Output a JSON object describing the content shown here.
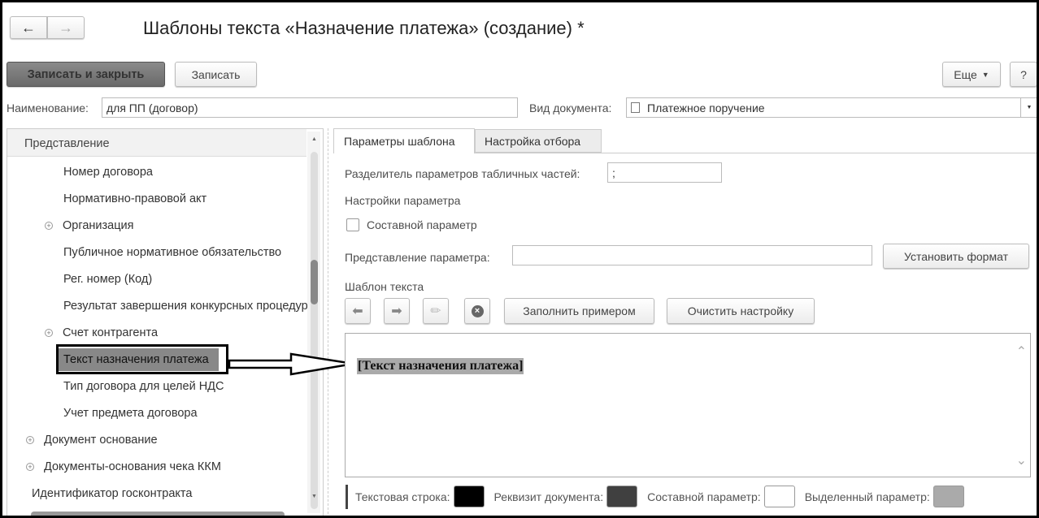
{
  "header": {
    "title": "Шаблоны текста «Назначение платежа» (создание) *"
  },
  "toolbar": {
    "save_close": "Записать и закрыть",
    "save": "Записать",
    "more": "Еще",
    "help": "?"
  },
  "form": {
    "name_label": "Наименование:",
    "name_value": "для ПП (договор)",
    "doctype_label": "Вид документа:",
    "doctype_value": "Платежное поручение"
  },
  "tree": {
    "header": "Представление",
    "items": [
      {
        "label": "Номер договора",
        "expandable": false
      },
      {
        "label": "Нормативно-правовой акт",
        "expandable": false
      },
      {
        "label": "Организация",
        "expandable": true
      },
      {
        "label": "Публичное нормативное обязательство",
        "expandable": false
      },
      {
        "label": "Рег. номер (Код)",
        "expandable": false
      },
      {
        "label": "Результат завершения конкурсных процедур",
        "expandable": false
      },
      {
        "label": "Счет контрагента",
        "expandable": true
      },
      {
        "label": "Текст назначения платежа",
        "expandable": false,
        "selected": true
      },
      {
        "label": "Тип договора для целей НДС",
        "expandable": false
      },
      {
        "label": "Учет предмета договора",
        "expandable": false
      },
      {
        "label": "Документ основание",
        "expandable": true
      },
      {
        "label": "Документы-основания чека ККМ",
        "expandable": true
      },
      {
        "label": "Идентификатор госконтракта",
        "expandable": false
      }
    ]
  },
  "tabs": [
    "Параметры шаблона",
    "Настройка отбора"
  ],
  "params": {
    "separator_label": "Разделитель параметров табличных частей:",
    "separator_value": ";",
    "settings_heading": "Настройки параметра",
    "composite_label": "Составной параметр",
    "presentation_label": "Представление параметра:",
    "presentation_value": "",
    "set_format": "Установить формат",
    "template_heading": "Шаблон текста",
    "fill_example": "Заполнить примером",
    "clear_settings": "Очистить настройку",
    "template_text": "[Текст назначения платежа]"
  },
  "legend": [
    {
      "label": "Текстовая строка:",
      "color": "#000000"
    },
    {
      "label": "Реквизит документа:",
      "color": "#404040"
    },
    {
      "label": "Составной параметр:",
      "color": "#ffffff"
    },
    {
      "label": "Выделенный параметр:",
      "color": "#aaaaaa"
    }
  ]
}
